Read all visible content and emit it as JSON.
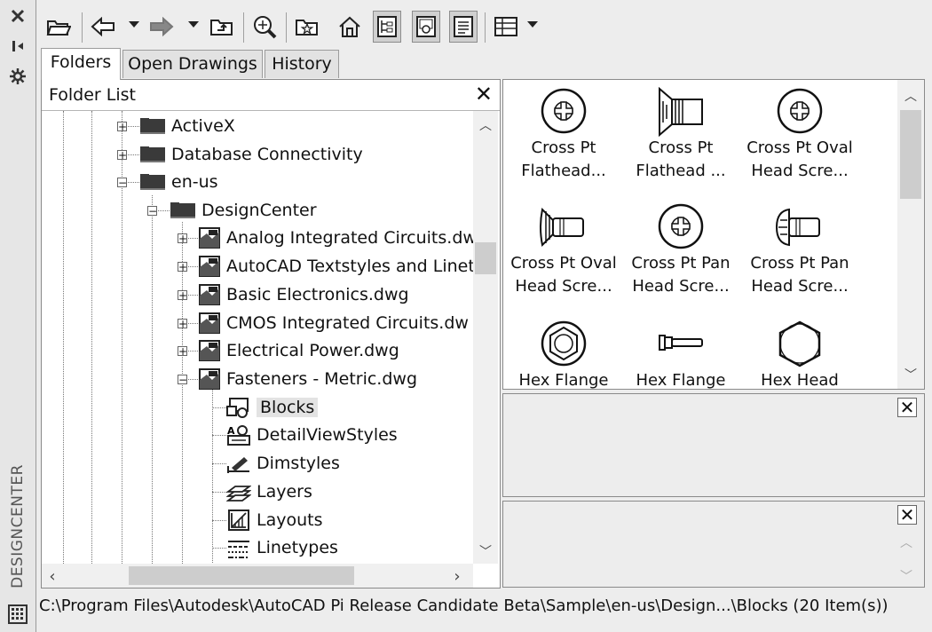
{
  "palette_title": "DESIGNCENTER",
  "tabs": [
    {
      "label": "Folders"
    },
    {
      "label": "Open Drawings"
    },
    {
      "label": "History"
    }
  ],
  "tree": {
    "header": "Folder List",
    "close_glyph": "✕",
    "items": [
      {
        "label": "ActiveX",
        "icon": "folder-icon",
        "expander": "+"
      },
      {
        "label": "Database Connectivity",
        "icon": "folder-icon",
        "expander": "+"
      },
      {
        "label": "en-us",
        "icon": "folder-icon",
        "expander": "−"
      },
      {
        "label": "DesignCenter",
        "icon": "folder-icon",
        "expander": "−"
      },
      {
        "label": "Analog Integrated Circuits.dw",
        "icon": "drawing-file-icon",
        "expander": "+"
      },
      {
        "label": "AutoCAD Textstyles and Linet",
        "icon": "drawing-file-icon",
        "expander": "+"
      },
      {
        "label": "Basic Electronics.dwg",
        "icon": "drawing-file-icon",
        "expander": "+"
      },
      {
        "label": "CMOS Integrated Circuits.dw",
        "icon": "drawing-file-icon",
        "expander": "+"
      },
      {
        "label": "Electrical Power.dwg",
        "icon": "drawing-file-icon",
        "expander": "+"
      },
      {
        "label": "Fasteners - Metric.dwg",
        "icon": "drawing-file-icon",
        "expander": "−"
      },
      {
        "label": "Blocks",
        "icon": "blocks-icon",
        "selected": true
      },
      {
        "label": "DetailViewStyles",
        "icon": "detail-view-styles-icon"
      },
      {
        "label": "Dimstyles",
        "icon": "dimstyles-icon"
      },
      {
        "label": "Layers",
        "icon": "layers-icon"
      },
      {
        "label": "Layouts",
        "icon": "layouts-icon"
      },
      {
        "label": "Linetypes",
        "icon": "linetypes-icon"
      }
    ]
  },
  "palette": {
    "blocks": [
      {
        "line1": "Cross Pt",
        "line2": "Flathead...",
        "icon": "cross-pt-head-icon"
      },
      {
        "line1": "Cross Pt",
        "line2": "Flathead ...",
        "icon": "flathead-screw-side-icon"
      },
      {
        "line1": "Cross Pt Oval",
        "line2": "Head Scre...",
        "icon": "cross-pt-head-icon"
      },
      {
        "line1": "Cross Pt Oval",
        "line2": "Head Scre...",
        "icon": "oval-head-screw-side-icon"
      },
      {
        "line1": "Cross Pt Pan",
        "line2": "Head Scre...",
        "icon": "cross-pt-head-icon"
      },
      {
        "line1": "Cross Pt Pan",
        "line2": "Head Scre...",
        "icon": "pan-head-screw-side-icon"
      },
      {
        "line1": "Hex Flange",
        "line2": "",
        "icon": "hex-flange-head-icon"
      },
      {
        "line1": "Hex Flange",
        "line2": "",
        "icon": "hex-flange-side-icon"
      },
      {
        "line1": "Hex Head",
        "line2": "",
        "icon": "hex-head-icon"
      }
    ]
  },
  "preview": {
    "close_glyph": "✕"
  },
  "description": {
    "close_glyph": "✕"
  },
  "status_bar": "C:\\Program Files\\Autodesk\\AutoCAD Pi Release Candidate Beta\\Sample\\en-us\\Design...\\Blocks (20 Item(s))"
}
